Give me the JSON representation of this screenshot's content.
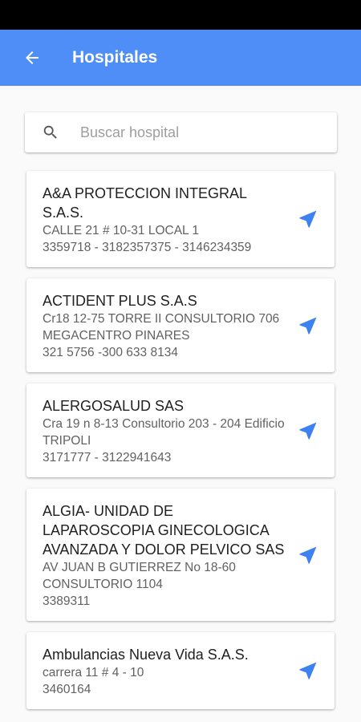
{
  "header": {
    "title": "Hospitales"
  },
  "search": {
    "placeholder": "Buscar hospital",
    "value": ""
  },
  "colors": {
    "primary": "#4f8ef7",
    "nav_icon": "#3d82f0"
  },
  "hospitals": [
    {
      "name": "A&A PROTECCION INTEGRAL S.A.S.",
      "address": "CALLE 21 # 10-31 LOCAL 1",
      "phone": "3359718 - 3182357375 - 3146234359"
    },
    {
      "name": "ACTIDENT PLUS S.A.S",
      "address": "Cr18 12-75 TORRE II CONSULTORIO 706 MEGACENTRO PINARES",
      "phone": "321 5756 -300 633 8134"
    },
    {
      "name": "ALERGOSALUD SAS",
      "address": "Cra 19 n 8-13 Consultorio 203 - 204 Edificio TRIPOLI",
      "phone": "3171777 - 3122941643"
    },
    {
      "name": "ALGIA- UNIDAD DE LAPAROSCOPIA GINECOLOGICA AVANZADA Y DOLOR PELVICO SAS",
      "address": "AV JUAN B GUTIERREZ No 18-60 CONSULTORIO 1104",
      "phone": "3389311"
    },
    {
      "name": "Ambulancias Nueva Vida S.A.S.",
      "address": "carrera 11 # 4 - 10",
      "phone": "3460164"
    }
  ]
}
